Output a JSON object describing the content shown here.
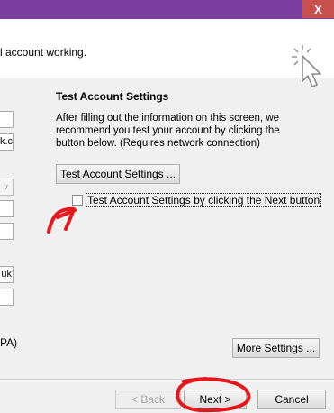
{
  "window": {
    "close_glyph": "X"
  },
  "header": {
    "text": "l account working."
  },
  "left_form": {
    "field_email_partial": "k.cc",
    "field_user_partial": "uk",
    "spa_partial": "PA)"
  },
  "test_section": {
    "title": "Test Account Settings",
    "description": "After filling out the information on this screen, we recommend you test your account by clicking the button below. (Requires network connection)",
    "test_button": "Test Account Settings ...",
    "checkbox_label": "Test Account Settings by clicking the Next button",
    "checkbox_checked": false,
    "more_settings_button": "More Settings ..."
  },
  "footer": {
    "back_button": "< Back",
    "next_button": "Next >",
    "cancel_button": "Cancel"
  },
  "annotation_color": "#e4181c"
}
